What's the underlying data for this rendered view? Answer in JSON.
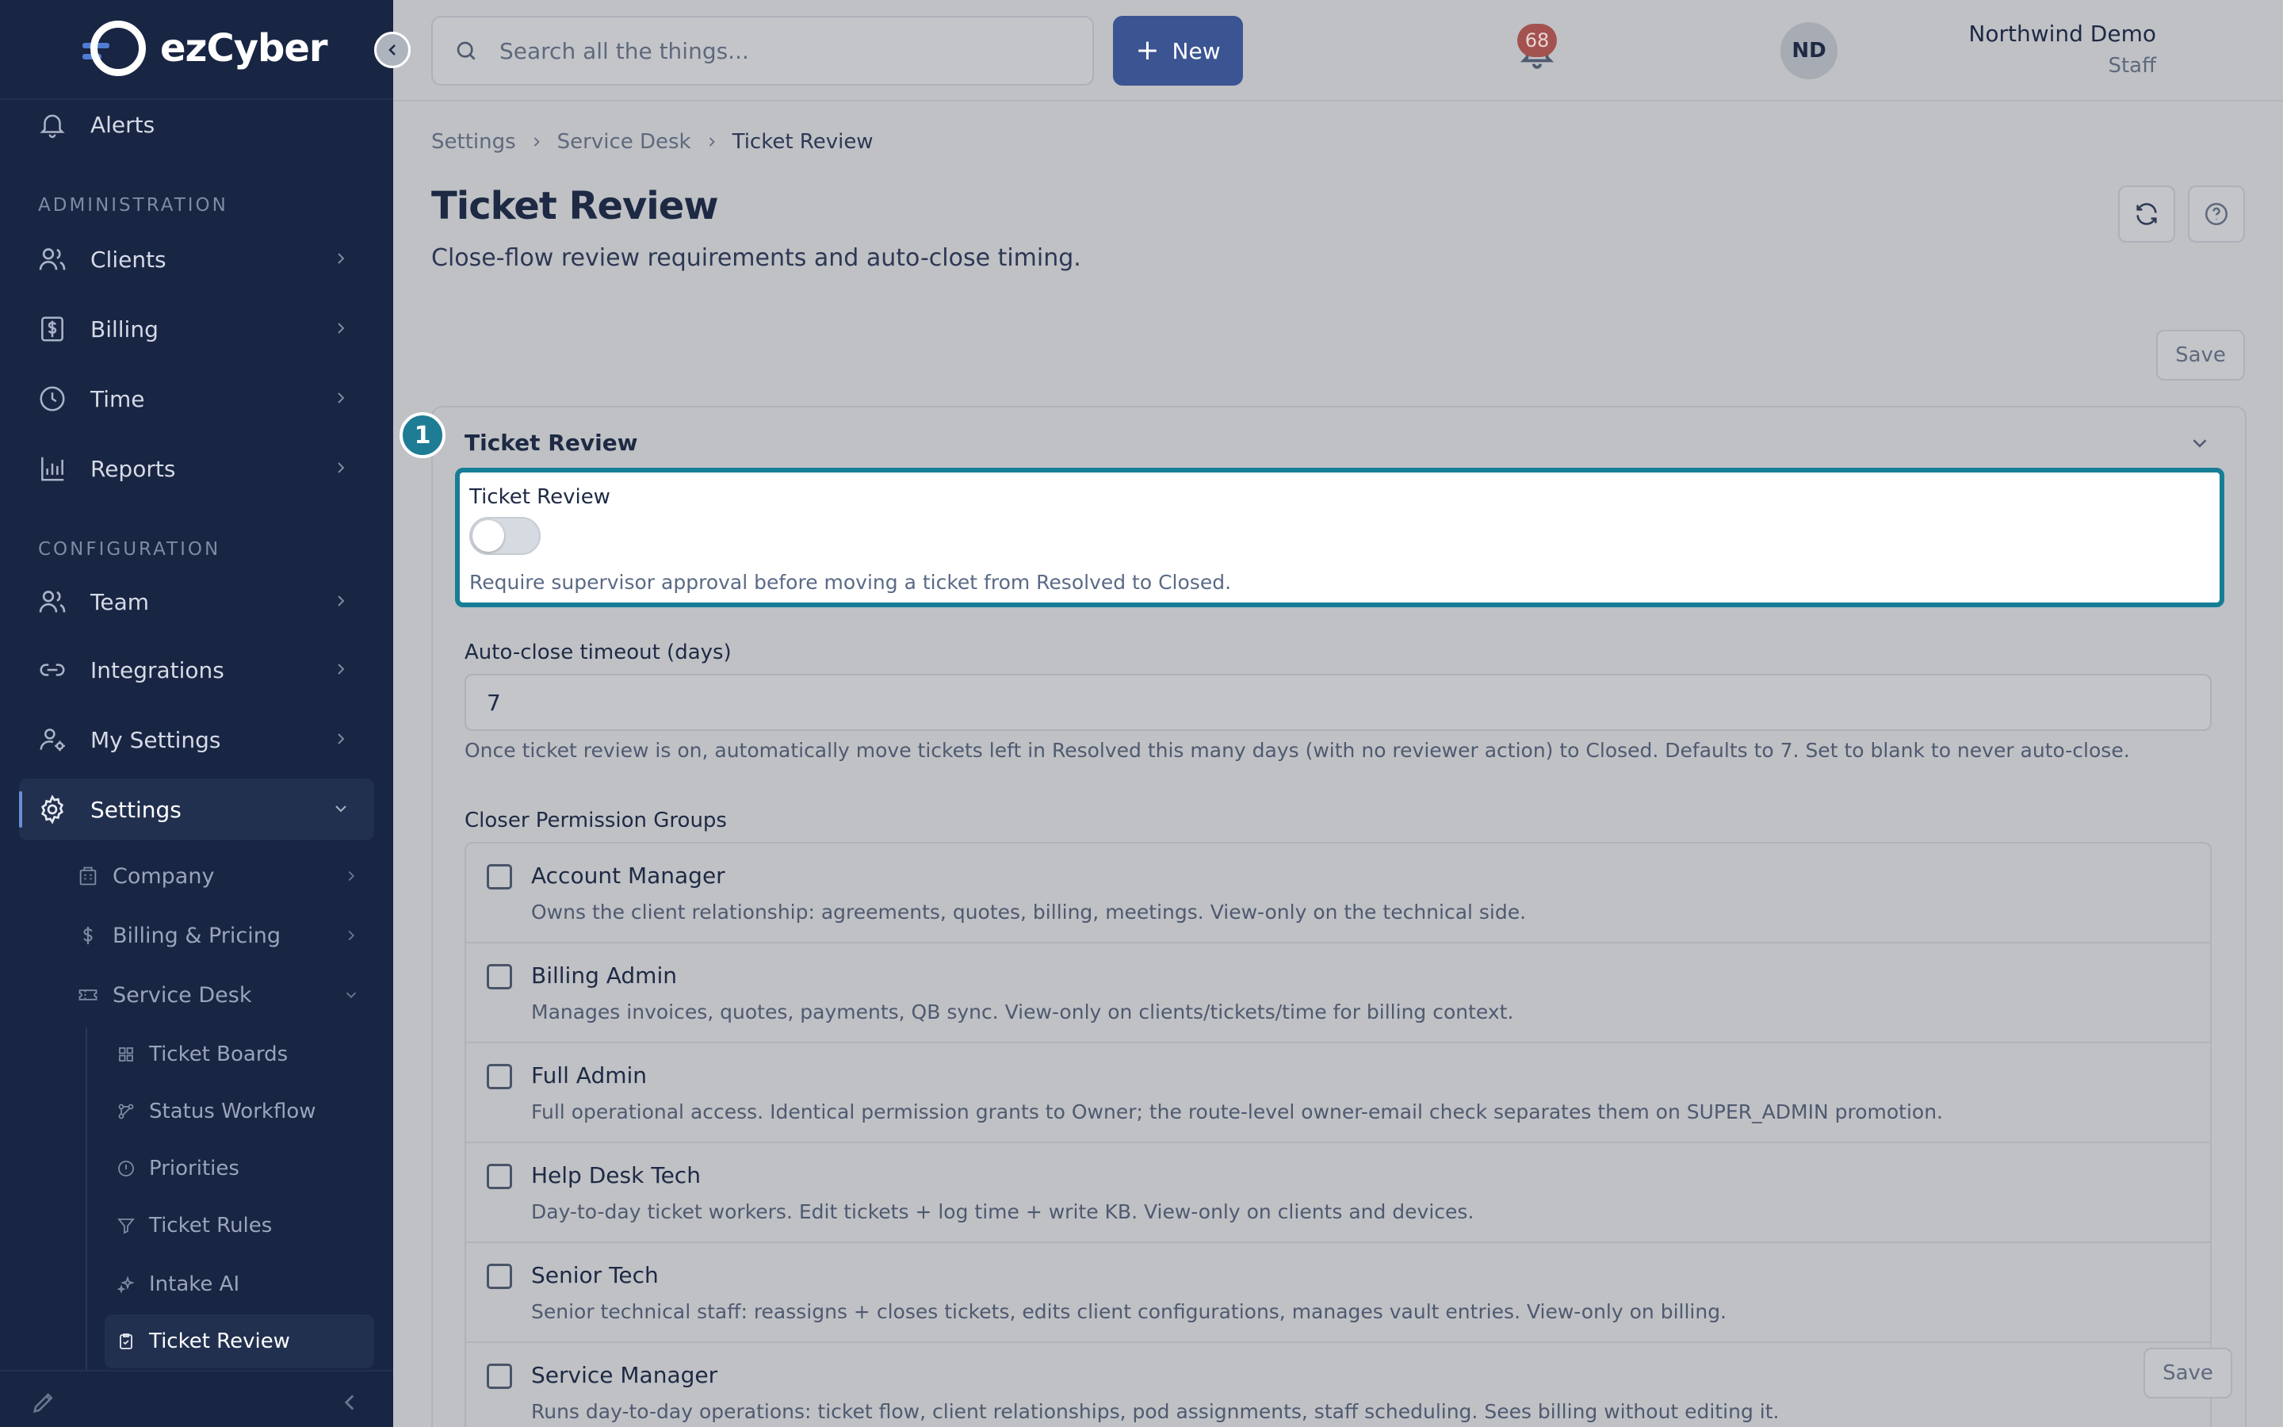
{
  "app": {
    "logo_text": "ezCyber"
  },
  "sidebar": {
    "top_item": "Alerts",
    "sections": {
      "administration": "ADMINISTRATION",
      "configuration": "CONFIGURATION"
    },
    "admin_items": [
      "Clients",
      "Billing",
      "Time",
      "Reports"
    ],
    "config_items": [
      "Team",
      "Integrations",
      "My Settings",
      "Settings"
    ],
    "settings_children": [
      "Company",
      "Billing & Pricing",
      "Service Desk"
    ],
    "service_desk_children": [
      "Ticket Boards",
      "Status Workflow",
      "Priorities",
      "Ticket Rules",
      "Intake AI",
      "Ticket Review"
    ],
    "active_item": "Ticket Review"
  },
  "header": {
    "search_placeholder": "Search all the things...",
    "new_label": "New",
    "notification_count": "68",
    "user_name": "Northwind Demo",
    "user_role": "Staff",
    "avatar_initials": "ND"
  },
  "breadcrumb": [
    "Settings",
    "Service Desk",
    "Ticket Review"
  ],
  "page": {
    "title": "Ticket Review",
    "subtitle": "Close-flow review requirements and auto-close timing.",
    "save_label": "Save"
  },
  "card": {
    "step_number": "1",
    "title": "Ticket Review",
    "toggle": {
      "label": "Ticket Review",
      "enabled": false,
      "help": "Require supervisor approval before moving a ticket from Resolved to Closed."
    },
    "auto_close": {
      "label": "Auto-close timeout (days)",
      "value": "7",
      "help": "Once ticket review is on, automatically move tickets left in Resolved this many days (with no reviewer action) to Closed. Defaults to 7. Set to blank to never auto-close."
    },
    "groups_label": "Closer Permission Groups",
    "groups": [
      {
        "name": "Account Manager",
        "description": "Owns the client relationship: agreements, quotes, billing, meetings. View-only on the technical side.",
        "checked": false
      },
      {
        "name": "Billing Admin",
        "description": "Manages invoices, quotes, payments, QB sync. View-only on clients/tickets/time for billing context.",
        "checked": false
      },
      {
        "name": "Full Admin",
        "description": "Full operational access. Identical permission grants to Owner; the route-level owner-email check separates them on SUPER_ADMIN promotion.",
        "checked": false
      },
      {
        "name": "Help Desk Tech",
        "description": "Day-to-day ticket workers. Edit tickets + log time + write KB. View-only on clients and devices.",
        "checked": false
      },
      {
        "name": "Senior Tech",
        "description": "Senior technical staff: reassigns + closes tickets, edits client configurations, manages vault entries. View-only on billing.",
        "checked": false
      },
      {
        "name": "Service Manager",
        "description": "Runs day-to-day operations: ticket flow, client relationships, pod assignments, staff scheduling. Sees billing without editing it.",
        "checked": false
      }
    ]
  },
  "colors": {
    "sidebar_bg": "#182543",
    "primary": "#3b5492",
    "highlight": "#167e96",
    "badge": "#a3524f"
  },
  "icons": {
    "alerts": "bell-icon",
    "clients": "users-icon",
    "billing": "dollar-square-icon",
    "time": "clock-icon",
    "reports": "bar-chart-icon",
    "team": "users-icon",
    "integrations": "link-icon",
    "my_settings": "user-gear-icon",
    "settings": "gear-icon"
  }
}
